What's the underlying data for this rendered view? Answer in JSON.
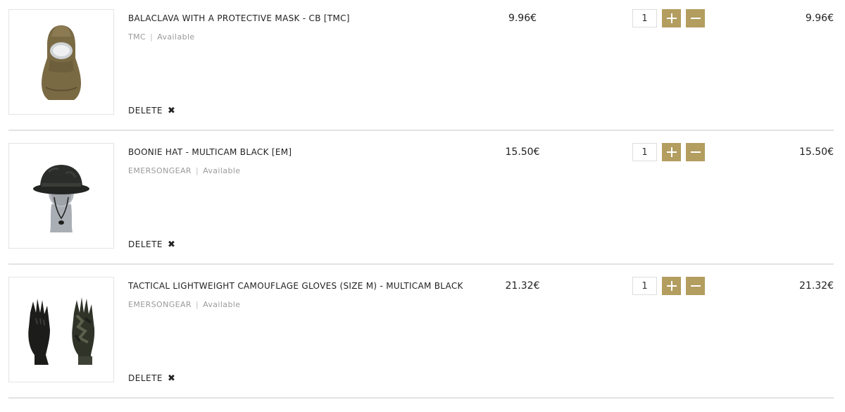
{
  "cart": {
    "items": [
      {
        "title": "BALACLAVA WITH A PROTECTIVE MASK - CB [TMC]",
        "brand": "TMC",
        "availability": "Available",
        "delete_label": "DELETE",
        "delete_icon": "close-x-icon",
        "unit_price": "9.96€",
        "quantity": "1",
        "total": "9.96€",
        "image": "balaclava-image"
      },
      {
        "title": "BOONIE HAT - MULTICAM BLACK [EM]",
        "brand": "EMERSONGEAR",
        "availability": "Available",
        "delete_label": "DELETE",
        "delete_icon": "close-x-icon",
        "unit_price": "15.50€",
        "quantity": "1",
        "total": "15.50€",
        "image": "boonie-hat-image"
      },
      {
        "title": "TACTICAL LIGHTWEIGHT CAMOUFLAGE GLOVES (SIZE M) - MULTICAM BLACK",
        "brand": "EMERSONGEAR",
        "availability": "Available",
        "delete_label": "DELETE",
        "delete_icon": "close-x-icon",
        "unit_price": "21.32€",
        "quantity": "1",
        "total": "21.32€",
        "image": "gloves-image"
      }
    ]
  },
  "colors": {
    "accent": "#b39d5f",
    "separator": "#e3e3e3",
    "muted_text": "#9a9a9a"
  }
}
